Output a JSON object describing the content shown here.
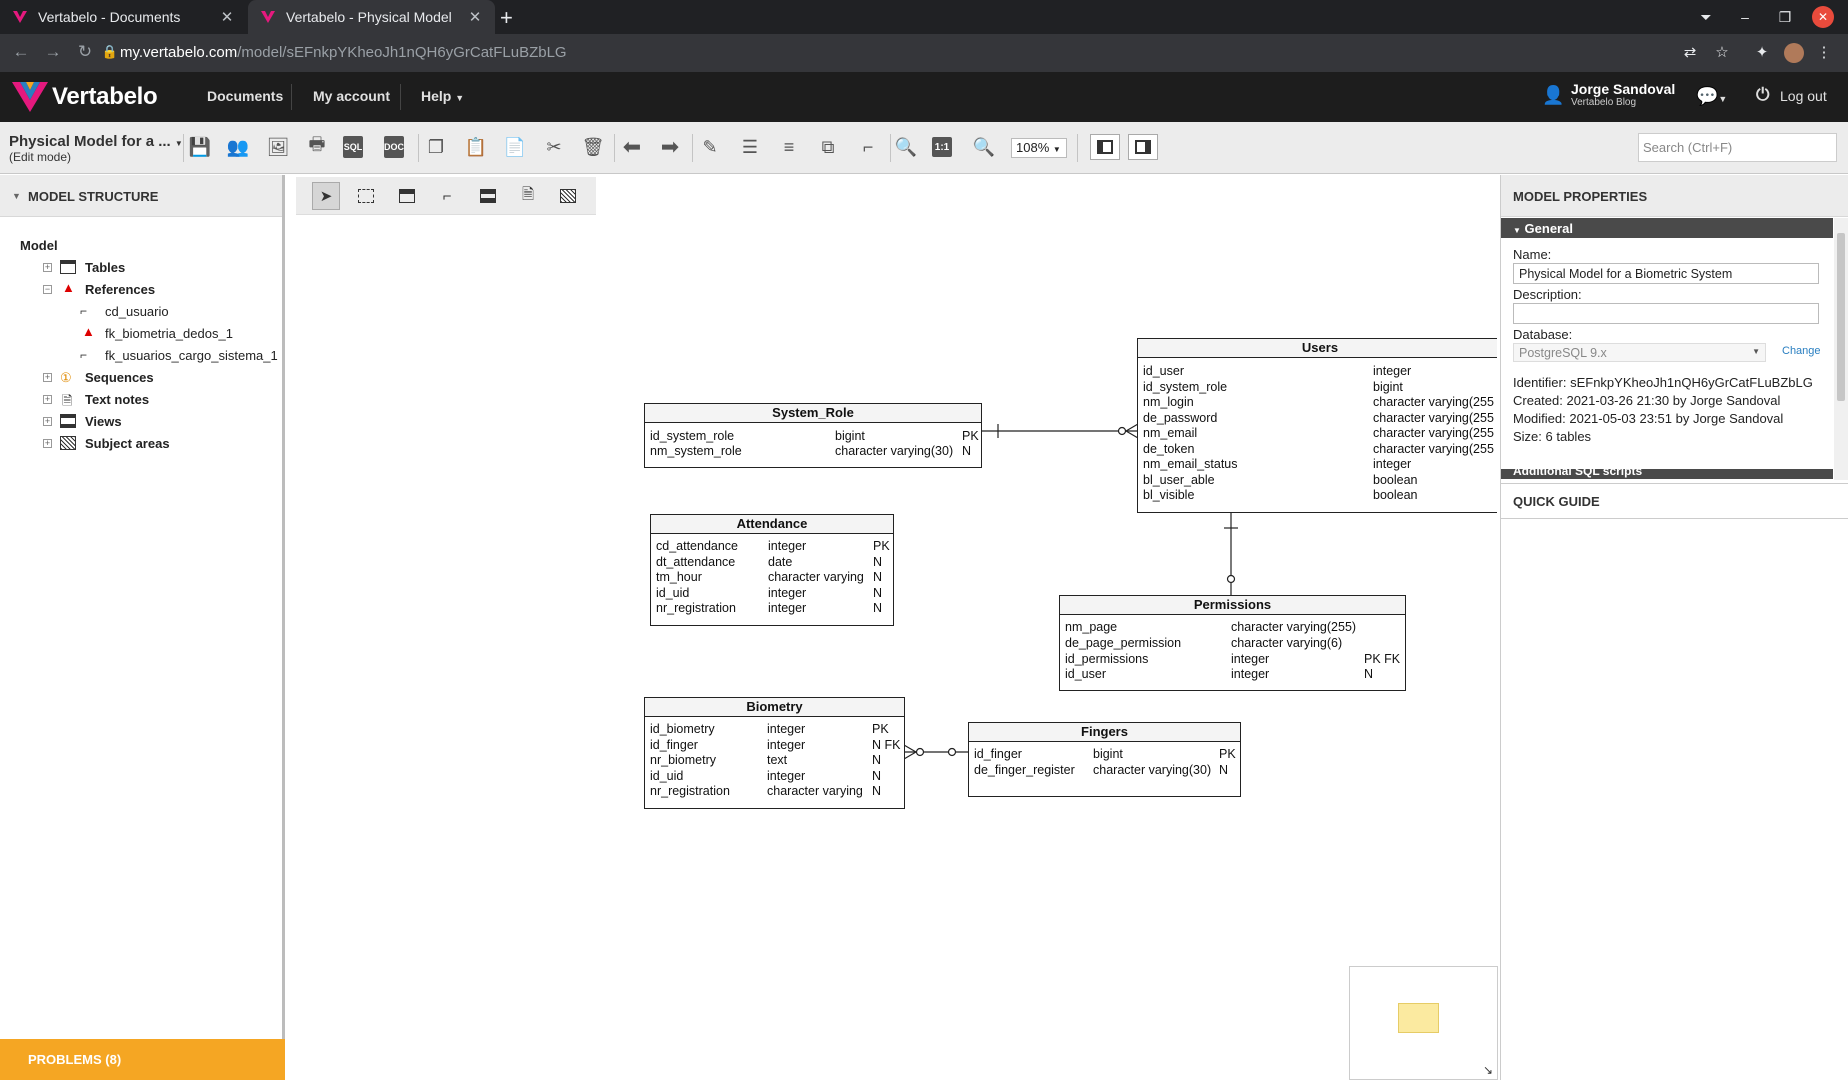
{
  "browser": {
    "tabs": [
      {
        "title": "Vertabelo - Documents",
        "active": false
      },
      {
        "title": "Vertabelo - Physical Model",
        "active": true
      }
    ],
    "url_domain": "my.vertabelo.com",
    "url_path": "/model/sEFnkpYKheoJh1nQH6yGrCatFLuBZbLG"
  },
  "topnav": {
    "logo": "Vertabelo",
    "items": [
      "Documents",
      "My account",
      "Help"
    ],
    "user_name": "Jorge Sandoval",
    "user_sub": "Vertabelo Blog",
    "logout": "Log out"
  },
  "toolbar": {
    "model_title": "Physical Model for a ...",
    "model_mode": "(Edit mode)",
    "zoom": "108%",
    "search_placeholder": "Search (Ctrl+F)",
    "sql_label": "SQL",
    "doc_label": "DOC",
    "fit_label": "1:1"
  },
  "left": {
    "header": "MODEL STRUCTURE",
    "root": "Model",
    "items": [
      {
        "label": "Tables",
        "expanded": false
      },
      {
        "label": "References",
        "expanded": true,
        "warning": true
      },
      {
        "label": "Sequences",
        "expanded": false
      },
      {
        "label": "Text notes",
        "expanded": false
      },
      {
        "label": "Views",
        "expanded": false
      },
      {
        "label": "Subject areas",
        "expanded": false
      }
    ],
    "references": [
      "cd_usuario",
      "fk_biometria_dedos_1",
      "fk_usuarios_cargo_sistema_1"
    ],
    "problems": "PROBLEMS (8)"
  },
  "tables": {
    "system_role": {
      "name": "System_Role",
      "columns": [
        {
          "name": "id_system_role",
          "type": "bigint",
          "flag": "PK"
        },
        {
          "name": "nm_system_role",
          "type": "character varying(30)",
          "flag": "N"
        }
      ]
    },
    "users": {
      "name": "Users",
      "columns": [
        {
          "name": "id_user",
          "type": "integer",
          "flag": ""
        },
        {
          "name": "id_system_role",
          "type": "bigint",
          "flag": ""
        },
        {
          "name": "nm_login",
          "type": "character varying(255",
          "flag": ""
        },
        {
          "name": "de_password",
          "type": "character varying(255",
          "flag": ""
        },
        {
          "name": "nm_email",
          "type": "character varying(255",
          "flag": ""
        },
        {
          "name": "de_token",
          "type": "character varying(255",
          "flag": ""
        },
        {
          "name": "nm_email_status",
          "type": "integer",
          "flag": ""
        },
        {
          "name": "bl_user_able",
          "type": "boolean",
          "flag": ""
        },
        {
          "name": "bl_visible",
          "type": "boolean",
          "flag": ""
        }
      ]
    },
    "attendance": {
      "name": "Attendance",
      "columns": [
        {
          "name": "cd_attendance",
          "type": "integer",
          "flag": "PK"
        },
        {
          "name": "dt_attendance",
          "type": "date",
          "flag": "N"
        },
        {
          "name": "tm_hour",
          "type": "character varying",
          "flag": "N"
        },
        {
          "name": "id_uid",
          "type": "integer",
          "flag": "N"
        },
        {
          "name": "nr_registration",
          "type": "integer",
          "flag": "N"
        }
      ]
    },
    "permissions": {
      "name": "Permissions",
      "columns": [
        {
          "name": "nm_page",
          "type": "character varying(255)",
          "flag": ""
        },
        {
          "name": "de_page_permission",
          "type": "character varying(6)",
          "flag": ""
        },
        {
          "name": "id_permissions",
          "type": "integer",
          "flag": "PK FK"
        },
        {
          "name": "id_user",
          "type": "integer",
          "flag": "N"
        }
      ]
    },
    "biometry": {
      "name": "Biometry",
      "columns": [
        {
          "name": "id_biometry",
          "type": "integer",
          "flag": "PK"
        },
        {
          "name": "id_finger",
          "type": "integer",
          "flag": "N FK"
        },
        {
          "name": "nr_biometry",
          "type": "text",
          "flag": "N"
        },
        {
          "name": "id_uid",
          "type": "integer",
          "flag": "N"
        },
        {
          "name": "nr_registration",
          "type": "character varying",
          "flag": "N"
        }
      ]
    },
    "fingers": {
      "name": "Fingers",
      "columns": [
        {
          "name": "id_finger",
          "type": "bigint",
          "flag": "PK"
        },
        {
          "name": "de_finger_register",
          "type": "character varying(30)",
          "flag": "N"
        }
      ]
    }
  },
  "right": {
    "header": "MODEL PROPERTIES",
    "section": "General",
    "name_label": "Name:",
    "name_value": "Physical Model for a Biometric System",
    "desc_label": "Description:",
    "desc_value": "",
    "db_label": "Database:",
    "db_value": "PostgreSQL 9.x",
    "change": "Change",
    "identifier": "Identifier: sEFnkpYKheoJh1nQH6yGrCatFLuBZbLG",
    "created": "Created: 2021-03-26 21:30 by Jorge Sandoval",
    "modified": "Modified: 2021-05-03 23:51 by Jorge Sandoval",
    "size": "Size: 6 tables",
    "additional": "Additional SQL scripts",
    "quick_guide": "QUICK GUIDE"
  },
  "colors": {
    "brand_magenta": "#e5197e",
    "brand_blue": "#2a7fc1",
    "problems_bg": "#f5a623",
    "topnav_bg": "#1d1d1d"
  }
}
